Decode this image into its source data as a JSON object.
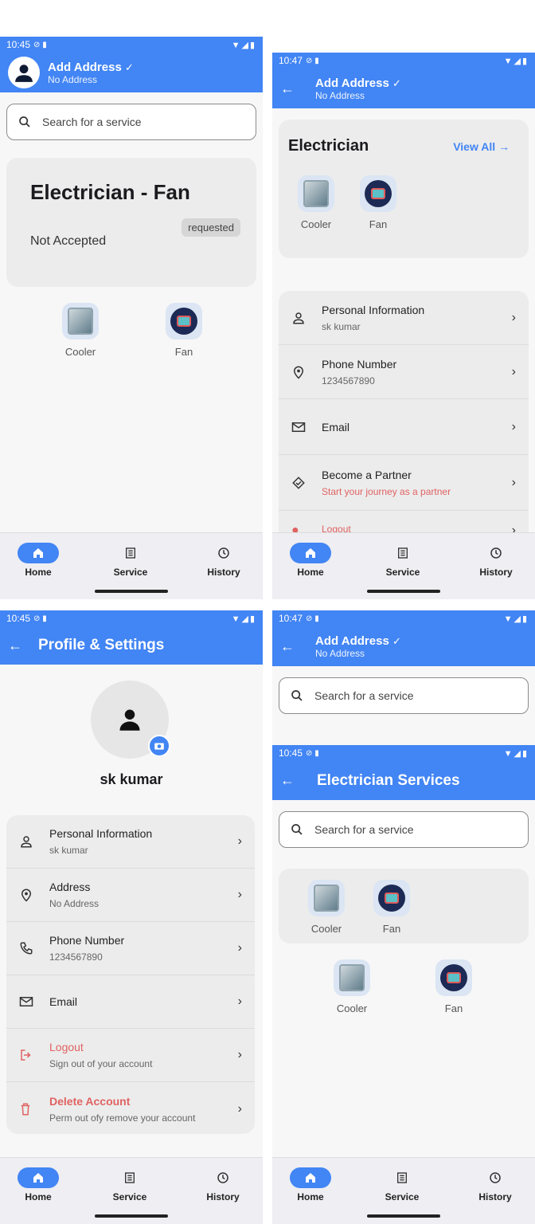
{
  "common": {
    "nav": {
      "home": "Home",
      "service": "Service",
      "history": "History"
    },
    "search_placeholder": "Search for a service",
    "address_title": "Add Address",
    "address_sub": "No Address",
    "cooler": "Cooler",
    "fan": "Fan"
  },
  "panel1": {
    "time": "10:45",
    "request_title": "Electrician - Fan",
    "request_status": "Not Accepted",
    "request_badge": "requested"
  },
  "panel2": {
    "time": "10:47",
    "category_title": "Electrician",
    "view_all": "View All",
    "rows": [
      {
        "title": "Personal Information",
        "sub": "sk kumar"
      },
      {
        "title": "Phone Number",
        "sub": "1234567890"
      },
      {
        "title": "Email",
        "sub": ""
      },
      {
        "title": "Become a Partner",
        "sub": "Start your journey as a partner"
      },
      {
        "title": "Logout",
        "sub": ""
      }
    ]
  },
  "panel3": {
    "time": "10:45",
    "title": "Profile & Settings",
    "user_name": "sk kumar",
    "rows": [
      {
        "title": "Personal Information",
        "sub": "sk kumar"
      },
      {
        "title": "Address",
        "sub": "No Address"
      },
      {
        "title": "Phone Number",
        "sub": "1234567890"
      },
      {
        "title": "Email",
        "sub": ""
      },
      {
        "title": "Logout",
        "sub": "Sign out of your account"
      },
      {
        "title": "Delete Account",
        "sub": "Perm out ofy remove your account"
      }
    ]
  },
  "panel4": {
    "time": "10:47",
    "time2": "10:45",
    "title2": "Electrician Services"
  },
  "colors": {
    "accent": "#4285f4",
    "danger": "#e06262"
  }
}
